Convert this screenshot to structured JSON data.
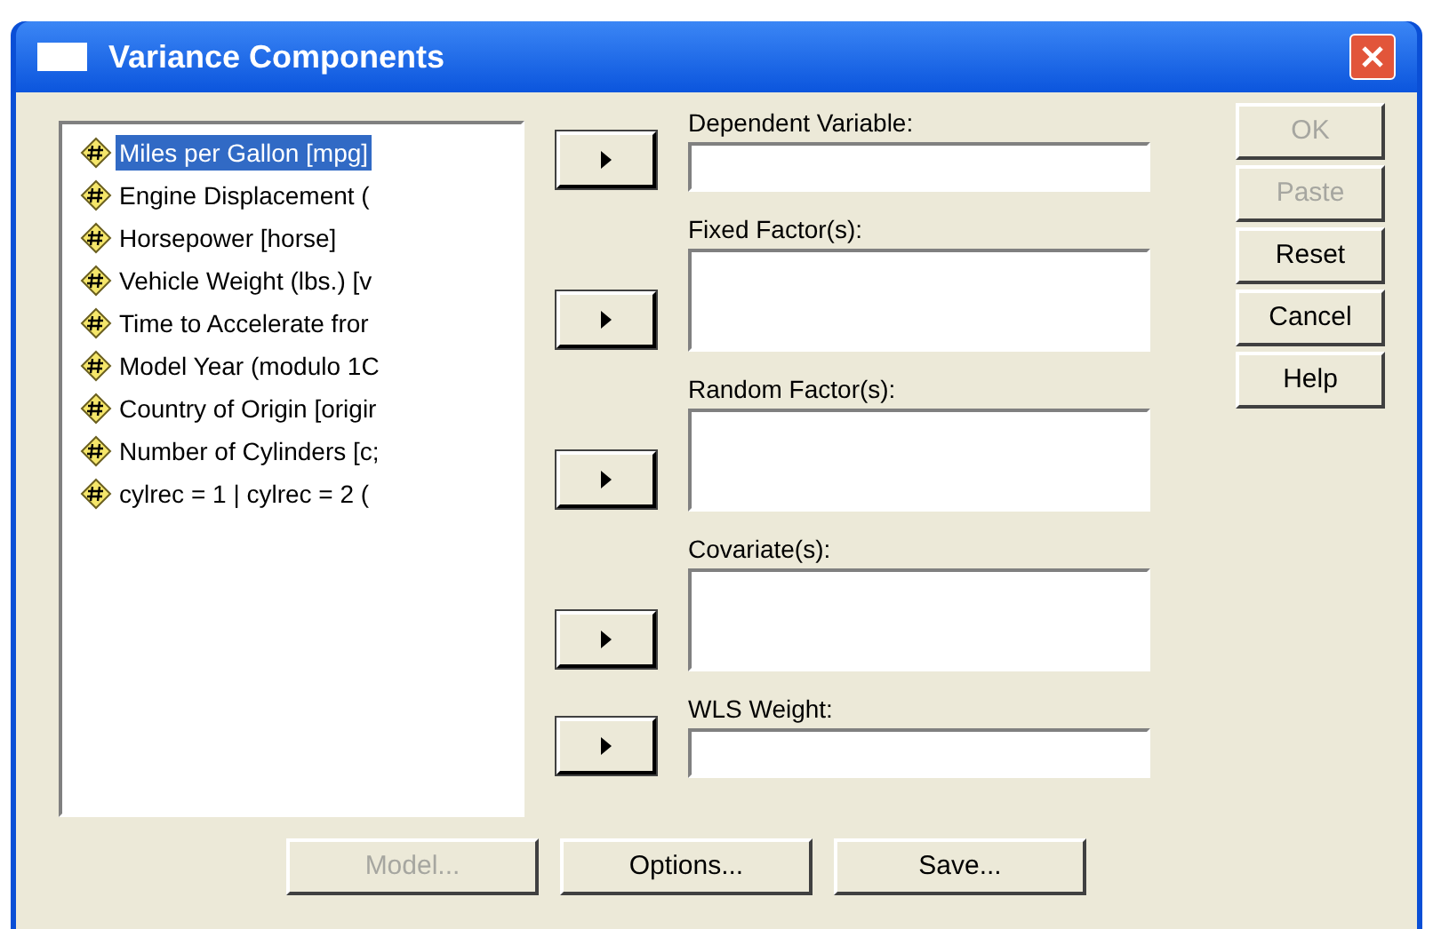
{
  "window": {
    "title": "Variance Components"
  },
  "variables": [
    {
      "label": "Miles per Gallon [mpg]",
      "selected": true
    },
    {
      "label": "Engine Displacement (",
      "selected": false
    },
    {
      "label": "Horsepower [horse]",
      "selected": false
    },
    {
      "label": "Vehicle Weight (lbs.) [v",
      "selected": false
    },
    {
      "label": "Time to Accelerate fror",
      "selected": false
    },
    {
      "label": "Model Year (modulo 1C",
      "selected": false
    },
    {
      "label": "Country of Origin [origir",
      "selected": false
    },
    {
      "label": "Number of Cylinders [c;",
      "selected": false
    },
    {
      "label": "cylrec = 1 | cylrec = 2 (",
      "selected": false
    }
  ],
  "targets": [
    {
      "label": "Dependent Variable:",
      "kind": "single"
    },
    {
      "label": "Fixed Factor(s):",
      "kind": "list"
    },
    {
      "label": "Random Factor(s):",
      "kind": "list"
    },
    {
      "label": "Covariate(s):",
      "kind": "list"
    },
    {
      "label": "WLS Weight:",
      "kind": "single"
    }
  ],
  "side_buttons": [
    {
      "label": "OK",
      "disabled": true
    },
    {
      "label": "Paste",
      "disabled": true
    },
    {
      "label": "Reset",
      "disabled": false
    },
    {
      "label": "Cancel",
      "disabled": false
    },
    {
      "label": "Help",
      "disabled": false
    }
  ],
  "bottom_buttons": [
    {
      "label": "Model...",
      "disabled": true
    },
    {
      "label": "Options...",
      "disabled": false
    },
    {
      "label": "Save...",
      "disabled": false
    }
  ]
}
